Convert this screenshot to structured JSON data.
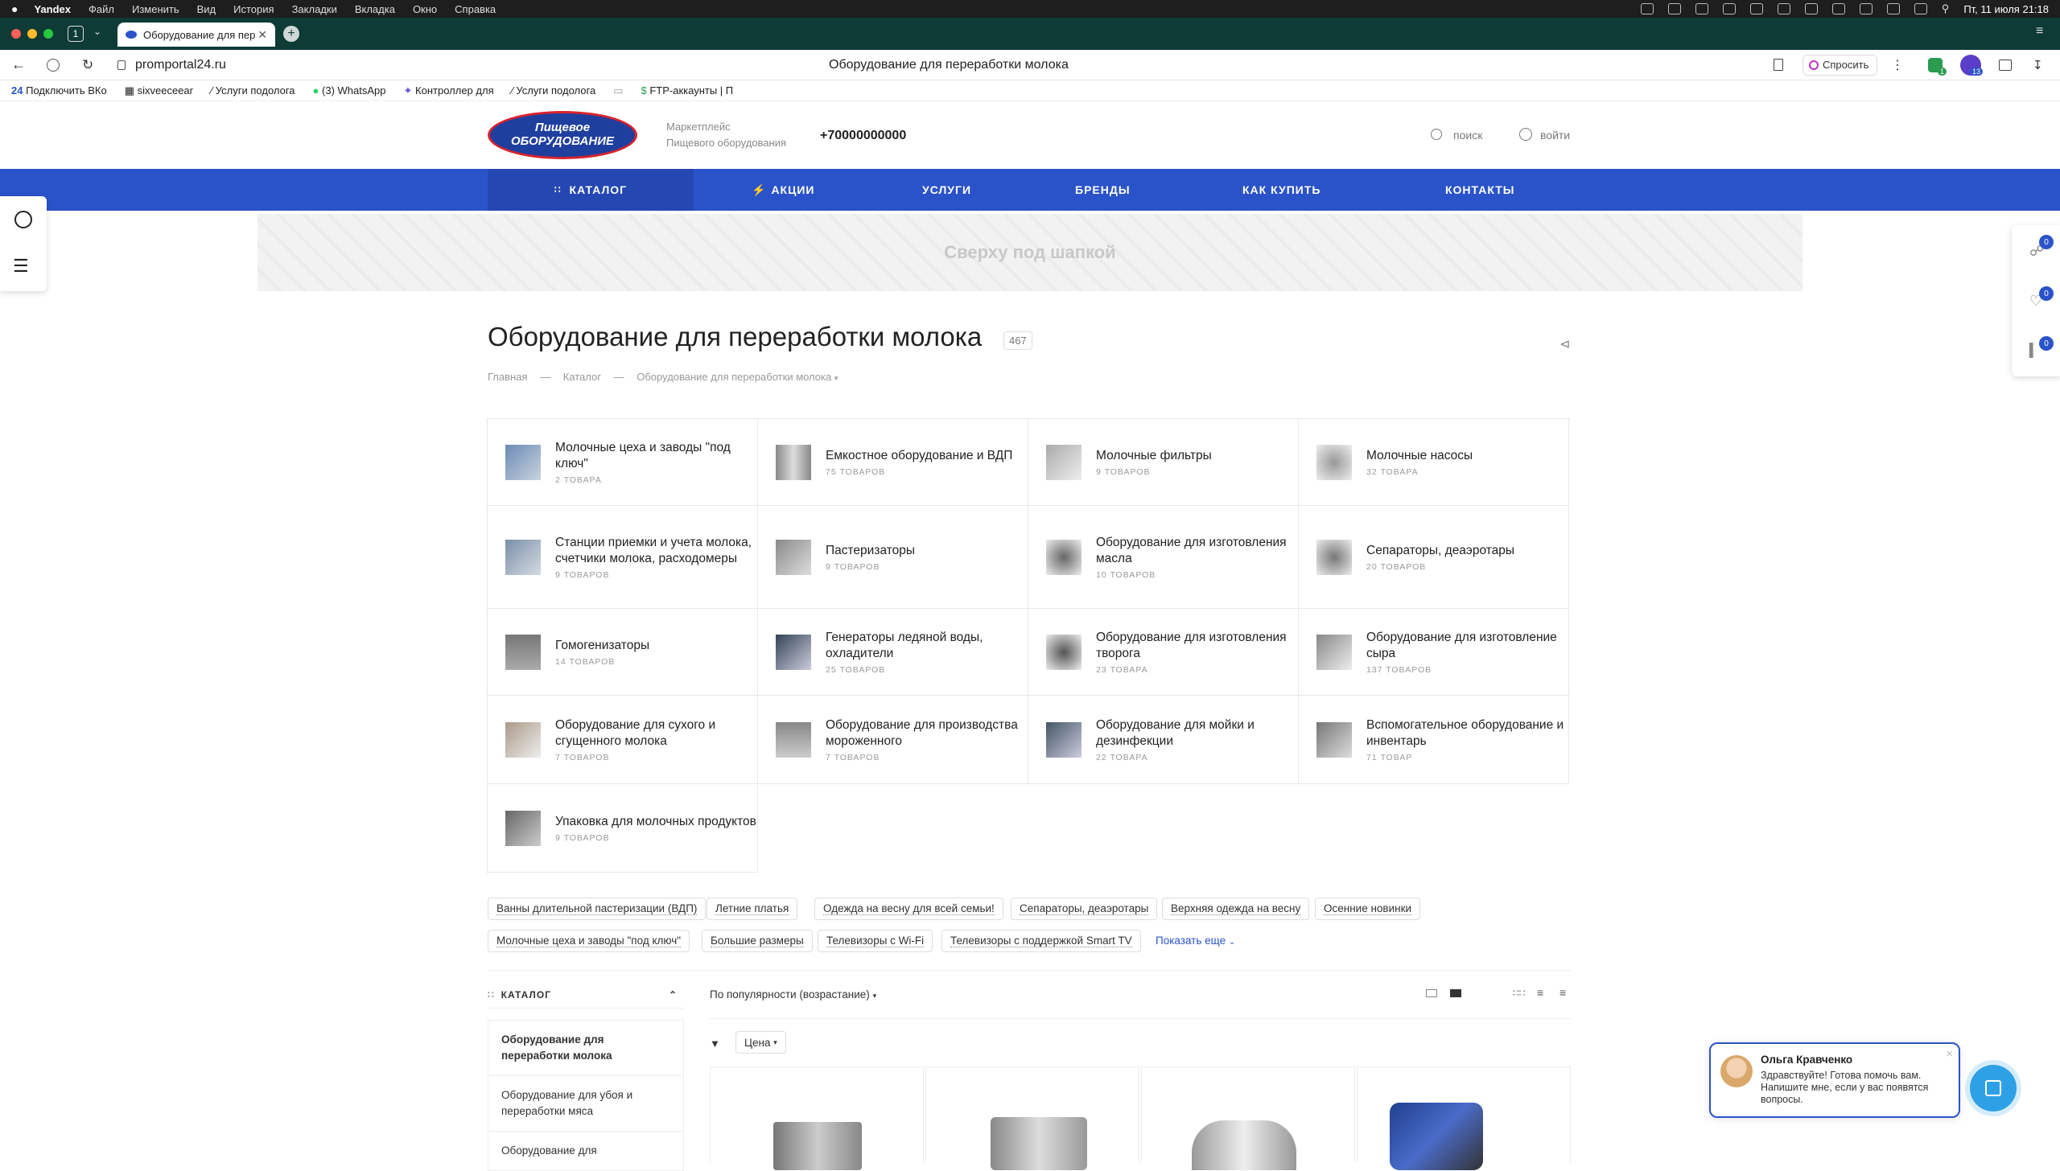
{
  "macbar": {
    "app": "Yandex",
    "menu": [
      "Файл",
      "Изменить",
      "Вид",
      "История",
      "Закладки",
      "Вкладка",
      "Окно",
      "Справка"
    ],
    "datetime": "Пт, 11 июля  21:18"
  },
  "tab": {
    "title": "Оборудование для пер",
    "count": "1"
  },
  "address": {
    "url": "promportal24.ru",
    "page_title": "Оборудование для переработки молока",
    "ask": "Спросить",
    "ext_badge1": "1",
    "ext_badge2": "13"
  },
  "bookmarks": [
    "Подключить ВКо",
    "sixveeceear",
    "Услуги подолога",
    "(3) WhatsApp",
    "Контроллер для",
    "Услуги подолога",
    "FTP-аккаунты | П"
  ],
  "header": {
    "logo_line1": "Пищевое",
    "logo_line2": "оборудование",
    "tagline1": "Маркетплейс",
    "tagline2": "Пищевого оборудования",
    "phone": "+70000000000",
    "search": "поиск",
    "login": "войти"
  },
  "nav": [
    "КАТАЛОГ",
    "АКЦИИ",
    "УСЛУГИ",
    "БРЕНДЫ",
    "КАК КУПИТЬ",
    "КОНТАКТЫ"
  ],
  "banner": "Сверху под шапкой",
  "page": {
    "title": "Оборудование для переработки молока",
    "count": "467",
    "crumbs": [
      "Главная",
      "Каталог",
      "Оборудование для переработки молока"
    ]
  },
  "categories": [
    {
      "name": "Молочные цеха и заводы \"под ключ\"",
      "sub": "2 товара"
    },
    {
      "name": "Емкостное оборудование и ВДП",
      "sub": "75 товаров"
    },
    {
      "name": "Молочные фильтры",
      "sub": "9 товаров"
    },
    {
      "name": "Молочные насосы",
      "sub": "32 товара"
    },
    {
      "name": "Станции приемки и учета молока, счетчики молока, расходомеры",
      "sub": "9 товаров"
    },
    {
      "name": "Пастеризаторы",
      "sub": "9 товаров"
    },
    {
      "name": "Оборудование для изготовления масла",
      "sub": "10 товаров"
    },
    {
      "name": "Сепараторы, деаэротары",
      "sub": "20 товаров"
    },
    {
      "name": "Гомогенизаторы",
      "sub": "14 товаров"
    },
    {
      "name": "Генераторы ледяной воды, охладители",
      "sub": "25 товаров"
    },
    {
      "name": "Оборудование для изготовления творога",
      "sub": "23 товара"
    },
    {
      "name": "Оборудование для изготовление сыра",
      "sub": "137 товаров"
    },
    {
      "name": "Оборудование для сухого и сгущенного молока",
      "sub": "7 товаров"
    },
    {
      "name": "Оборудование для производства мороженного",
      "sub": "7 товаров"
    },
    {
      "name": "Оборудование для мойки и дезинфекции",
      "sub": "22 товара"
    },
    {
      "name": "Вспомогательное оборудование и инвентарь",
      "sub": "71 товар"
    },
    {
      "name": "Упаковка для молочных продуктов",
      "sub": "9 товаров"
    }
  ],
  "tags": [
    "Ванны длительной пастеризации (ВДП)",
    "Летние платья",
    "Одежда на весну для всей семьи!",
    "Сепараторы, деаэротары",
    "Верхняя одежда на весну",
    "Осенние новинки",
    "Молочные цеха и заводы \"под ключ\"",
    "Большие размеры",
    "Телевизоры с Wi-Fi",
    "Телевизоры с поддержкой Smart TV"
  ],
  "show_more": "Показать еще",
  "sidebar": {
    "title": "КАТАЛОГ",
    "items": [
      "Оборудование для переработки молока",
      "Оборудование для убоя и переработки мяса",
      "Оборудование для"
    ]
  },
  "sort": {
    "label": "По популярности (возрастание)",
    "filter": "Цена"
  },
  "right_badges": [
    "0",
    "0",
    "0"
  ],
  "chat": {
    "name": "Ольга Кравченко",
    "message": "Здравствуйте! Готова помочь вам. Напишите мне, если у вас появятся вопросы."
  },
  "colors": {
    "brand": "#2b53c9",
    "tabbar": "#0e3b36"
  }
}
